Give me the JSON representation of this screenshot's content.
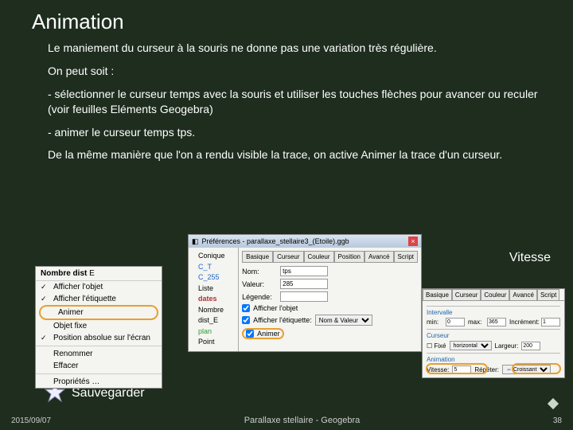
{
  "title": "Animation",
  "para1": "Le maniement du curseur à la souris ne donne pas une variation très régulière.",
  "para2": "On peut soit :",
  "para3": "- sélectionner le curseur temps avec la souris et utiliser les touches flèches pour avancer ou reculer (voir feuilles Eléments Geogebra)",
  "para4": "- animer le curseur temps tps.",
  "para5": "De la même manière que l'on a rendu visible la trace, on active Animer la trace d'un curseur.",
  "label_vitesse": "Vitesse",
  "label_sauveg": "Sauvegarder",
  "footer": {
    "date": "2015/09/07",
    "title": "Parallaxe stellaire - Geogebra",
    "page": "38"
  },
  "p1": {
    "header_label": "Nombre dist",
    "header_var": "E",
    "items": {
      "afficher_objet": "Afficher l'objet",
      "afficher_etiquette": "Afficher l'étiquette",
      "animer": "Animer",
      "objet_fixe": "Objet fixe",
      "position_abs": "Position absolue sur l'écran",
      "renommer": "Renommer",
      "effacer": "Effacer",
      "proprietes": "Propriétés …"
    }
  },
  "p2": {
    "titlebar": "Préférences - parallaxe_stellaire3_(Etoile).ggb",
    "tree": [
      "Conique",
      "C_T",
      "C_255",
      "Liste",
      "dates",
      "Nombre",
      "dist_E",
      "plan",
      "Point"
    ],
    "tabs": [
      "Basique",
      "Curseur",
      "Couleur",
      "Position",
      "Avancé",
      "Script"
    ],
    "rows": {
      "nom_l": "Nom:",
      "nom_v": "tps",
      "val_l": "Valeur:",
      "val_v": "285",
      "leg_l": "Légende:"
    },
    "cbs": {
      "afficher_objet": "Afficher l'objet",
      "afficher_etiq": "Afficher l'étiquette:",
      "etiq_sel": "Nom & Valeur",
      "animer": "Animer"
    }
  },
  "p3": {
    "tabs": [
      "Basique",
      "Curseur",
      "Couleur",
      "Avancé",
      "Script"
    ],
    "intervalle": {
      "t": "Intervalle",
      "min_l": "min:",
      "min_v": "0",
      "max_l": "max:",
      "max_v": "365",
      "inc_l": "Incrément:",
      "inc_v": "1"
    },
    "curseur": {
      "t": "Curseur",
      "fixe": "☐ Fixé",
      "horiz": "horizontal",
      "larg_l": "Largeur:",
      "larg_v": "200"
    },
    "anim": {
      "t": "Animation",
      "vit_l": "Vitesse:",
      "vit_v": "5",
      "rep_l": "Répéter:",
      "rep_v": "⇔ Croissant"
    }
  }
}
